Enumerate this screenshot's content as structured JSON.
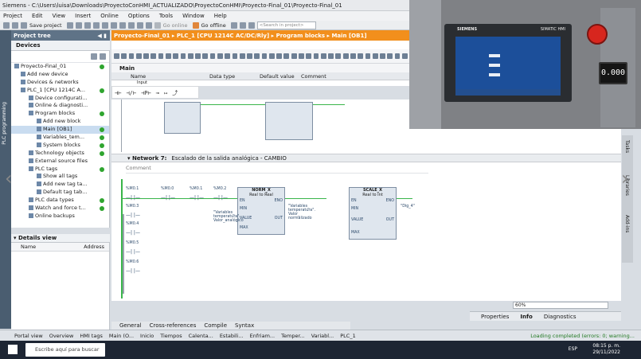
{
  "window": {
    "title": "Siemens  -  C:\\Users\\luisa\\Downloads\\ProyectoConHMI_ACTUALIZADO\\ProyectoConHMI\\Proyecto-Final_01\\Proyecto-Final_01"
  },
  "menu": [
    "Project",
    "Edit",
    "View",
    "Insert",
    "Online",
    "Options",
    "Tools",
    "Window",
    "Help"
  ],
  "toolbar": {
    "save_label": "Save project",
    "go_online": "Go online",
    "go_offline": "Go offline",
    "search_placeholder": "<Search in project>"
  },
  "project_tree": {
    "header": "Project tree",
    "devices_tab": "Devices",
    "side_label": "PLC programming",
    "items": [
      {
        "label": "Proyecto-Final_01",
        "dot": true
      },
      {
        "label": "Add new device",
        "dot": false
      },
      {
        "label": "Devices & networks",
        "dot": false
      },
      {
        "label": "PLC_1 [CPU 1214C A...",
        "dot": true
      },
      {
        "label": "Device configurati...",
        "dot": false
      },
      {
        "label": "Online & diagnosti...",
        "dot": false
      },
      {
        "label": "Program blocks",
        "dot": true
      },
      {
        "label": "Add new block",
        "dot": false
      },
      {
        "label": "Main [OB1]",
        "dot": true
      },
      {
        "label": "Variables_tem...",
        "dot": true
      },
      {
        "label": "System blocks",
        "dot": true
      },
      {
        "label": "Technology objects",
        "dot": true
      },
      {
        "label": "External source files",
        "dot": false
      },
      {
        "label": "PLC tags",
        "dot": true
      },
      {
        "label": "Show all tags",
        "dot": false
      },
      {
        "label": "Add new tag ta...",
        "dot": false
      },
      {
        "label": "Default tag tab...",
        "dot": false
      },
      {
        "label": "PLC data types",
        "dot": true
      },
      {
        "label": "Watch and force t...",
        "dot": true
      },
      {
        "label": "Online backups",
        "dot": false
      }
    ]
  },
  "details_view": {
    "header": "Details view",
    "col_name": "Name",
    "col_address": "Address"
  },
  "editor": {
    "breadcrumb": "Proyecto-Final_01  ▸  PLC_1 [CPU 1214C AC/DC/Rly]  ▸  Program blocks  ▸  Main [OB1]",
    "block_name": "Main",
    "interface_cols": [
      "Name",
      "Data type",
      "Default value",
      "Comment"
    ],
    "interface_row": "Input",
    "ladder_symbols": [
      "⊣⊢",
      "⊣/⊢",
      "⊣P⊢",
      "⊸",
      "↦",
      "⤴"
    ],
    "network_num": "Network 7:",
    "network_title": "Escalado de la salida analógica - CAMBIO",
    "comment": "Comment",
    "blocks": {
      "norm": {
        "title": "NORM_X",
        "sub": "Real to Real",
        "en": "EN",
        "eno": "ENO",
        "min": "MIN",
        "value": "VALUE",
        "max": "MAX",
        "out": "OUT"
      },
      "scale": {
        "title": "SCALE_X",
        "sub": "Real to Int",
        "en": "EN",
        "eno": "ENO",
        "min": "MIN",
        "value": "VALUE",
        "max": "MAX",
        "out": "OUT"
      }
    },
    "contacts": [
      "%M0.1",
      "%M0.0",
      "%M0.1",
      "%M0.2",
      "%M0.3",
      "%M0.4",
      "%M0.5",
      "%M0.6"
    ],
    "tags": {
      "n1_value": "\"Variables_\ntemperatura\".\nValor_analógico",
      "n1_out": "\"Variables_\ntemperatura\".\nValor_\nnormalizado",
      "n2_out": "\"Dig_4\""
    },
    "zoom": "60%"
  },
  "inspector": {
    "properties": "Properties",
    "info": "Info",
    "diagnostics": "Diagnostics"
  },
  "bottom_tabs": [
    "General",
    "Cross-references",
    "Compile",
    "Syntax"
  ],
  "portal": {
    "label": "Portal view",
    "tabs": [
      "Overview",
      "HMI tags",
      "Main (O...",
      "Inicio",
      "Tiempos",
      "Calenta...",
      "Estabili...",
      "Enfriam...",
      "Temper...",
      "Variabl...",
      "PLC_1"
    ],
    "status": "Loading completed (errors: 0; warning..."
  },
  "right_tabs": [
    "Tasks",
    "Libraries",
    "Add-ins"
  ],
  "video": {
    "hmi_brand": "SIEMENS",
    "hmi_model": "SIMATIC HMI",
    "led": "0.000"
  },
  "taskbar": {
    "search": "Escribe aquí para buscar",
    "lang": "ESP",
    "time": "08:15 p. m.",
    "date": "29/11/2022"
  },
  "colors": {
    "accent": "#f28f1c",
    "wire": "#39b54a",
    "tree_header": "#5f7387"
  }
}
